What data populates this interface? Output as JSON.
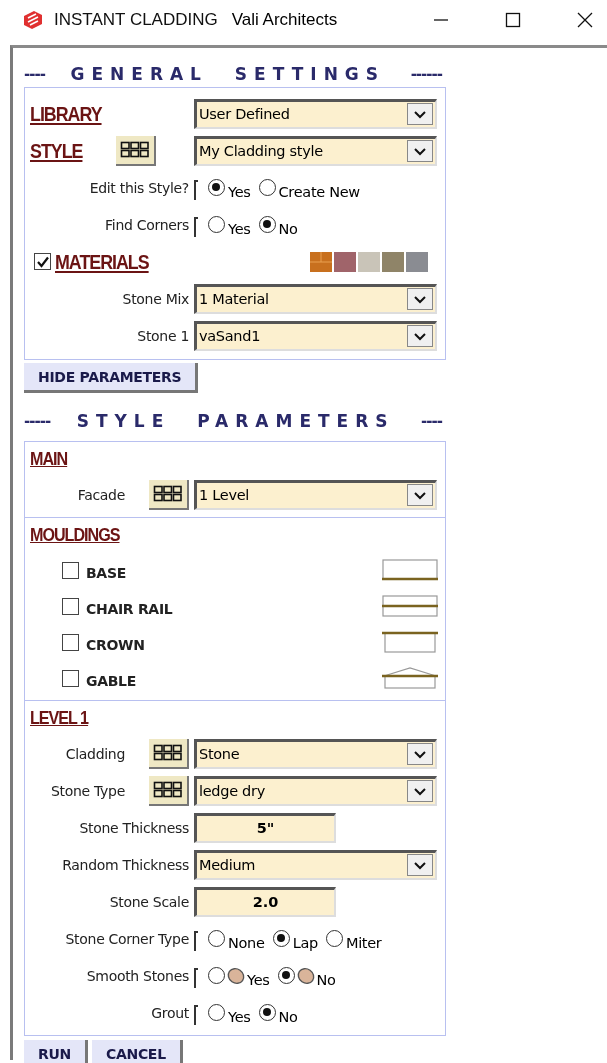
{
  "window": {
    "title": "INSTANT CLADDING",
    "subtitle": "Vali Architects"
  },
  "general_settings": {
    "dashes_left": "----",
    "title": "GENERAL SETTINGS",
    "dashes_right": "------",
    "rows": [
      {
        "kind": "heading_select",
        "label": "LIBRARY",
        "grid": false,
        "value": "User Defined"
      },
      {
        "kind": "heading_select",
        "label": "STYLE",
        "grid": true,
        "value": "My Cladding style"
      },
      {
        "kind": "radio",
        "label": "Edit this Style?",
        "options": [
          {
            "label": "Yes",
            "selected": true
          },
          {
            "label": "Create New",
            "selected": false
          }
        ]
      },
      {
        "kind": "radio",
        "label": "Find Corners",
        "options": [
          {
            "label": "Yes",
            "selected": false
          },
          {
            "label": "No",
            "selected": true
          }
        ]
      },
      {
        "kind": "check_heading",
        "label": "MATERIALS",
        "checked": true
      },
      {
        "kind": "select",
        "label": "Stone Mix",
        "grid": false,
        "value": "1 Material"
      },
      {
        "kind": "select",
        "label": "Stone 1",
        "grid": false,
        "value": "vaSand1"
      }
    ]
  },
  "hide_button": "HIDE PARAMETERS",
  "style_parameters": {
    "dashes_left": "-----",
    "title": "STYLE PARAMETERS",
    "dashes_right": "----",
    "panels": [
      {
        "title": "MAIN",
        "rows": [
          {
            "kind": "select",
            "label": "Facade",
            "grid": true,
            "value": "1 Level"
          }
        ]
      },
      {
        "title": "MOULDINGS",
        "mouldings": [
          {
            "kind": "base",
            "label": "BASE",
            "checked": false
          },
          {
            "kind": "chair_rail",
            "label": "CHAIR RAIL",
            "checked": false
          },
          {
            "kind": "crown",
            "label": "CROWN",
            "checked": false
          },
          {
            "kind": "gable",
            "label": "GABLE",
            "checked": false
          }
        ]
      },
      {
        "title": "LEVEL 1",
        "rows": [
          {
            "kind": "select",
            "label": "Cladding",
            "grid": true,
            "value": "Stone"
          },
          {
            "kind": "select",
            "label": "Stone Type",
            "grid": true,
            "value": "ledge dry"
          },
          {
            "kind": "number",
            "label": "Stone Thickness",
            "value": "5\""
          },
          {
            "kind": "select",
            "label": "Random Thickness",
            "grid": false,
            "value": "Medium"
          },
          {
            "kind": "number",
            "label": "Stone Scale",
            "value": "2.0"
          },
          {
            "kind": "radio",
            "label": "Stone Corner Type",
            "options": [
              {
                "label": "None",
                "selected": false
              },
              {
                "label": "Lap",
                "selected": true
              },
              {
                "label": "Miter",
                "selected": false
              }
            ]
          },
          {
            "kind": "radio",
            "label": "Smooth Stones",
            "options": [
              {
                "label": "Yes",
                "selected": false,
                "pebble": true
              },
              {
                "label": "No",
                "selected": true,
                "pebble": true
              }
            ]
          },
          {
            "kind": "radio",
            "label": "Grout",
            "options": [
              {
                "label": "Yes",
                "selected": false
              },
              {
                "label": "No",
                "selected": true
              }
            ]
          }
        ]
      }
    ]
  },
  "buttons": [
    "RUN",
    "CANCEL"
  ]
}
